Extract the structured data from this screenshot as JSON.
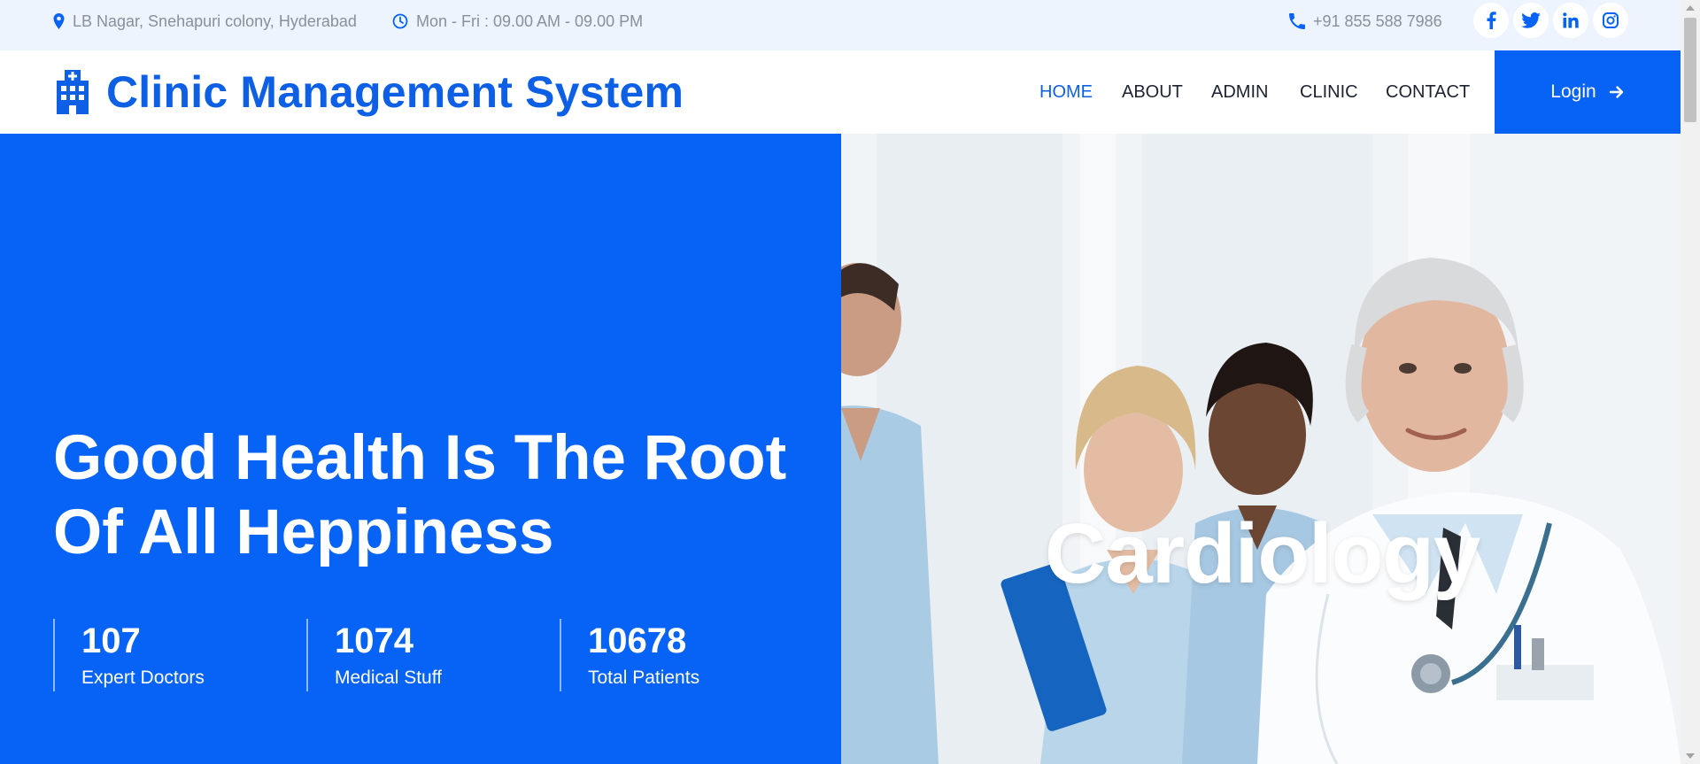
{
  "topbar": {
    "address": "LB Nagar, Snehapuri colony, Hyderabad",
    "hours": "Mon - Fri : 09.00 AM - 09.00 PM",
    "phone": "+91 855 588 7986",
    "social": [
      "facebook-icon",
      "twitter-icon",
      "linkedin-icon",
      "instagram-icon"
    ]
  },
  "header": {
    "brand": "Clinic Management System",
    "nav": [
      "HOME",
      "ABOUT",
      "ADMIN",
      "CLINIC",
      "CONTACT"
    ],
    "active_nav": "HOME",
    "login_label": "Login"
  },
  "hero": {
    "headline_line1": "Good Health Is The Root",
    "headline_line2": "Of All Heppiness",
    "stats": [
      {
        "number": "107",
        "label": "Expert Doctors"
      },
      {
        "number": "1074",
        "label": "Medical Stuff"
      },
      {
        "number": "10678",
        "label": "Total Patients"
      }
    ],
    "slide_title": "Cardiology"
  },
  "colors": {
    "primary": "#0763f5",
    "brand_text": "#0d5fe6",
    "topbar_bg": "#eef4fd",
    "nav_text": "#1c2230",
    "muted_text": "#8a8f98"
  }
}
